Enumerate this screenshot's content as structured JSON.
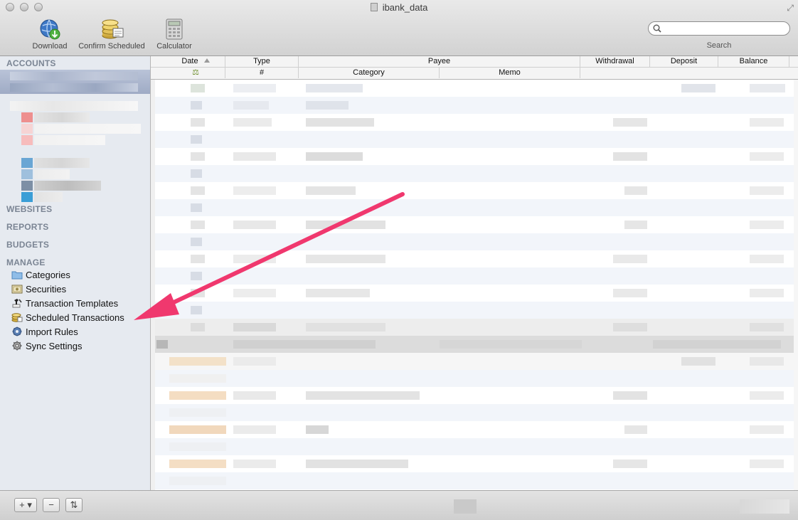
{
  "window": {
    "title": "ibank_data"
  },
  "toolbar": {
    "download_label": "Download",
    "confirm_label": "Confirm Scheduled",
    "calculator_label": "Calculator",
    "search_label": "Search",
    "search_value": ""
  },
  "sidebar": {
    "accounts": "ACCOUNTS",
    "websites": "WEBSITES",
    "reports": "REPORTS",
    "budgets": "BUDGETS",
    "manage": "MANAGE",
    "manage_items": [
      {
        "label": "Categories",
        "icon": "folder-icon"
      },
      {
        "label": "Securities",
        "icon": "certificate-icon"
      },
      {
        "label": "Transaction Templates",
        "icon": "stamp-icon"
      },
      {
        "label": "Scheduled Transactions",
        "icon": "coins-icon"
      },
      {
        "label": "Import Rules",
        "icon": "gear-badge-icon"
      },
      {
        "label": "Sync Settings",
        "icon": "gear-icon"
      }
    ]
  },
  "table": {
    "header_row1": {
      "date": "Date",
      "type": "Type",
      "payee": "Payee",
      "withdrawal": "Withdrawal",
      "deposit": "Deposit",
      "balance": "Balance"
    },
    "header_row2": {
      "cleared": "⚖",
      "number": "#",
      "category": "Category",
      "memo": "Memo"
    }
  },
  "bottombar": {
    "add": "+ ▾",
    "remove": "−",
    "sort": "⇅"
  },
  "colors": {
    "annotation_arrow": "#f0386e",
    "selection": "#a9b4cd",
    "row_alt": "#f2f5fa"
  }
}
